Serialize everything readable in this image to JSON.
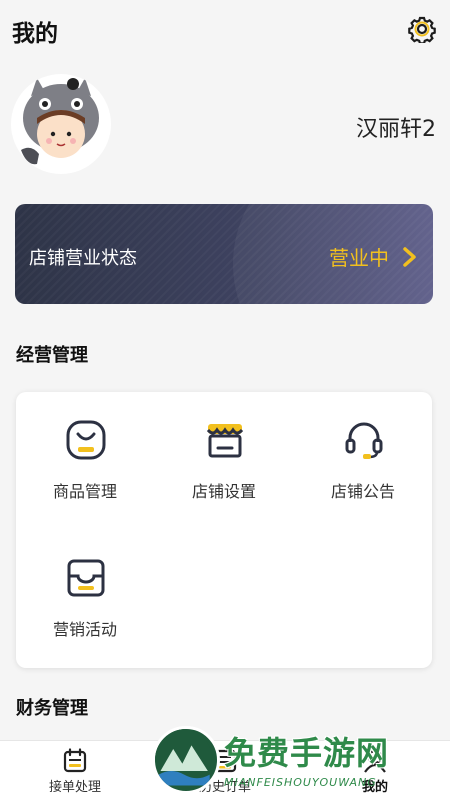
{
  "header": {
    "title": "我的",
    "settings_icon": "gear-icon"
  },
  "profile": {
    "avatar_icon": "avatar-icon",
    "username": "汉丽轩2"
  },
  "status_card": {
    "label": "店铺营业状态",
    "value": "营业中",
    "arrow_icon": "chevron-right-icon",
    "value_color": "#f2c01e"
  },
  "business_section": {
    "title": "经营管理",
    "items": [
      {
        "label": "商品管理",
        "icon": "product-icon"
      },
      {
        "label": "店铺设置",
        "icon": "store-icon"
      },
      {
        "label": "店铺公告",
        "icon": "headset-icon"
      },
      {
        "label": "营销活动",
        "icon": "wallet-icon"
      }
    ]
  },
  "finance_section": {
    "title": "财务管理"
  },
  "bottom_nav": {
    "items": [
      {
        "label": "接单处理",
        "icon": "order-icon"
      },
      {
        "label": "历史订单",
        "icon": "history-icon"
      },
      {
        "label": "我的",
        "icon": "profile-icon",
        "active": true
      }
    ]
  },
  "watermark": {
    "text": "免费手游网",
    "subtext": "MIANFEISHOUYOUWANG"
  },
  "colors": {
    "accent": "#f2c01e",
    "card_dark": "#2e3447",
    "brand_green": "#2f8a4a"
  }
}
